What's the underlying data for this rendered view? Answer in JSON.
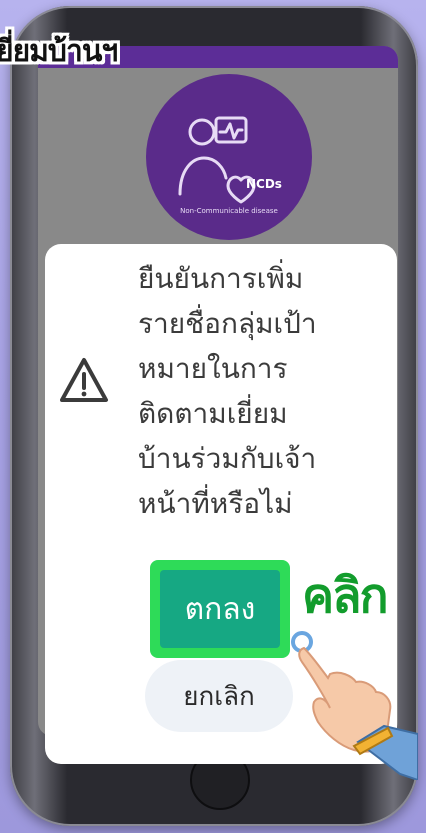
{
  "banner": {
    "text": "ยี่ยมบ้านฯ"
  },
  "app": {
    "logo_text": "NCDs",
    "logo_subtext": "Non-Communicable disease"
  },
  "dialog": {
    "message_lines": [
      "ยืนยันการเพิ่ม",
      "รายชื่อกลุ่มเป้า",
      "หมายในการ",
      "ติดตามเยี่ยม",
      "บ้านร่วมกับเจ้า",
      "หน้าที่หรือไม่"
    ],
    "confirm_label": "ตกลง",
    "cancel_label": "ยกเลิก"
  },
  "overlay": {
    "click_label": "คลิก"
  },
  "colors": {
    "confirm": "#16a883",
    "highlight": "#2edb58",
    "brand_purple": "#5a2b8a",
    "click_text": "#129c2c"
  },
  "icons": [
    "warning-triangle-icon",
    "health-heart-icon",
    "pointing-hand-icon"
  ]
}
